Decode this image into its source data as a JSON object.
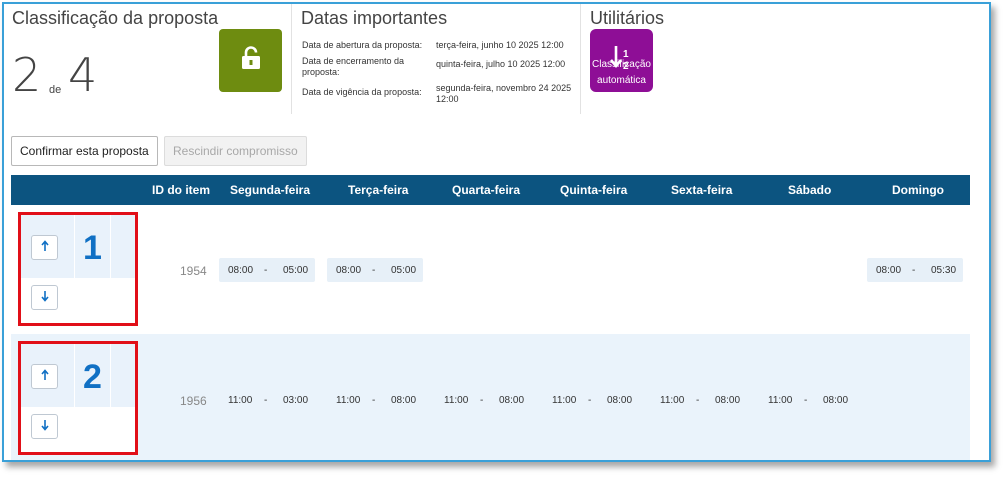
{
  "ranking": {
    "title": "Classificação da proposta",
    "current": "2",
    "of_label": "de",
    "total": "4",
    "lock_icon": "unlock-icon"
  },
  "dates": {
    "title": "Datas importantes",
    "rows": [
      {
        "label": "Data de abertura da proposta:",
        "value": "terça-feira, junho 10 2025 12:00"
      },
      {
        "label": "Data de encerramento da proposta:",
        "value": "quinta-feira, julho 10 2025 12:00"
      },
      {
        "label": "Data de vigência da proposta:",
        "value": "segunda-feira, novembro 24 2025 12:00"
      }
    ]
  },
  "utilities": {
    "title": "Utilitários",
    "auto_sort_line1": "Classificação",
    "auto_sort_line2": "automática",
    "auto_sort_icon": "sort-down-icon"
  },
  "actions": {
    "confirm": "Confirmar esta proposta",
    "rescind": "Rescindir compromisso"
  },
  "table": {
    "headers": [
      "ID do item",
      "Segunda-feira",
      "Terça-feira",
      "Quarta-feira",
      "Quinta-feira",
      "Sexta-feira",
      "Sábado",
      "Domingo"
    ],
    "separator": "-",
    "rows": [
      {
        "rank": "1",
        "item_id": "1954",
        "slots": {
          "mon": [
            "08:00",
            "05:00"
          ],
          "tue": [
            "08:00",
            "05:00"
          ],
          "sun": [
            "08:00",
            "05:30"
          ]
        }
      },
      {
        "rank": "2",
        "item_id": "1956",
        "slots": {
          "mon": [
            "11:00",
            "03:00"
          ],
          "tue": [
            "11:00",
            "08:00"
          ],
          "wed": [
            "11:00",
            "08:00"
          ],
          "thu": [
            "11:00",
            "08:00"
          ],
          "fri": [
            "11:00",
            "08:00"
          ],
          "sat": [
            "11:00",
            "08:00"
          ]
        }
      }
    ]
  },
  "colors": {
    "header_bg": "#0c5480",
    "lock_green": "#6e8c10",
    "auto_purple": "#8e0e96",
    "rank_blue": "#1070c4",
    "highlight_red": "#e10f18"
  }
}
